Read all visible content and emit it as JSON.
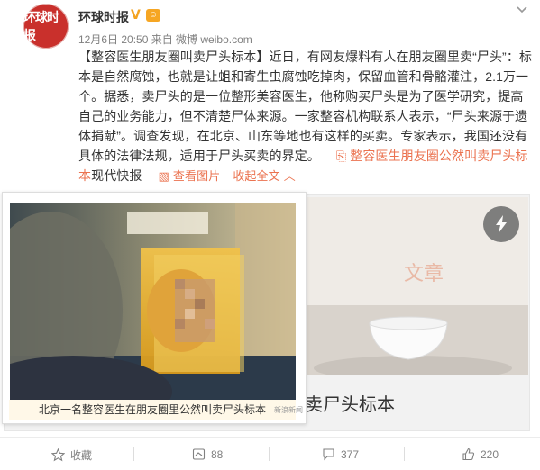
{
  "header": {
    "avatar_text": "环球时报",
    "username": "环球时报",
    "verified_icon": "verified-v-icon",
    "vip_icon": "vip-icon",
    "meta": "12月6日 20:50 来自 微博 weibo.com"
  },
  "post": {
    "line1": "【整容医生朋友圈叫卖尸头标本】近日，有网友爆料有人在朋友圈里卖“尸头”：标",
    "line2": "本是自然腐蚀，也就是让蛆和寄生虫腐蚀吃掉肉，保留血管和骨骼灌注，2.1万一",
    "line3": "个。据悉，卖尸头的是一位整形美容医生，他称购买尸头是为了医学研究，提高",
    "line4": "自己的业务能力，但不清楚尸体来源。一家整容机构联系人表示，“尸头来源于遗",
    "line5": "体捐献”。调查发现，在北京、山东等地也有这样的买卖。专家表示，我国还没有",
    "line6_a": "具体的法律法规，适用于尸头买卖的界定。",
    "line6_link": "整容医生朋友圈公然叫卖尸头标",
    "line7_a": "本",
    "line7_b": "现代快报",
    "view_image": "查看图片",
    "collapse": "收起全文"
  },
  "card": {
    "title": "卖尸头标本",
    "watermark": "文章",
    "play_icon": "lightning-icon"
  },
  "popup": {
    "caption": "北京一名整容医生在朋友圈里公然叫卖尸头标本",
    "watermark": "新浪新闻"
  },
  "actions": {
    "favorite": "收藏",
    "repost": "88",
    "comment": "377",
    "like": "220"
  },
  "colors": {
    "link": "#eb7350",
    "avatar_bg": "#c9302c",
    "verified": "#f3a321"
  }
}
